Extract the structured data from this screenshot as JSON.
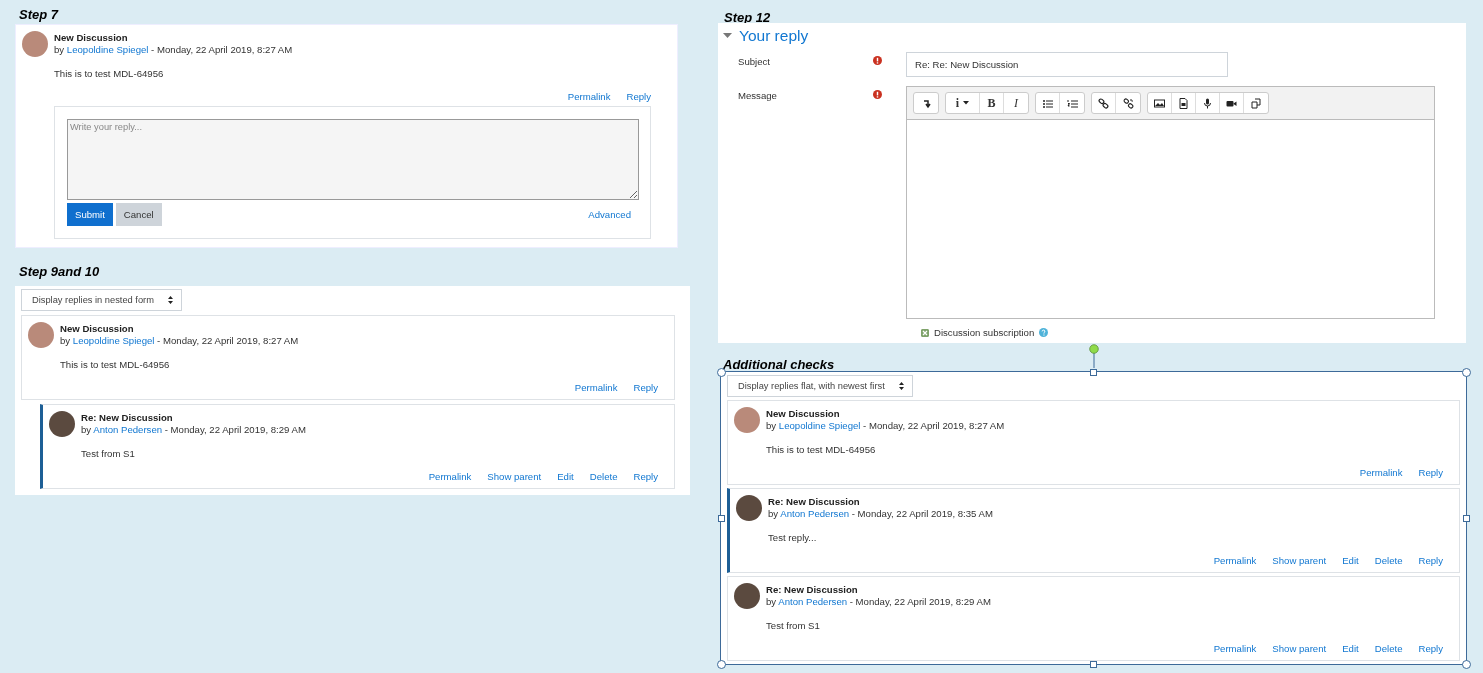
{
  "step7": {
    "caption": "Step 7",
    "post": {
      "subject": "New Discussion",
      "by": "by",
      "author": "Leopoldine Spiegel",
      "date": "- Monday, 22 April 2019, 8:27 AM",
      "message": "This is to test MDL-64956",
      "actions": [
        "Permalink",
        "Reply"
      ],
      "accent_bar": false
    },
    "reply_form": {
      "placeholder": "Write your reply...",
      "submit": "Submit",
      "cancel": "Cancel",
      "advanced": "Advanced"
    }
  },
  "step9": {
    "caption": "Step 9and 10",
    "display_mode": "Display replies in nested form",
    "posts": [
      {
        "subject": "New Discussion",
        "by": "by",
        "author": "Leopoldine Spiegel",
        "date": "- Monday, 22 April 2019, 8:27 AM",
        "message": "This is to test MDL-64956",
        "actions": [
          "Permalink",
          "Reply"
        ],
        "accent_bar": false,
        "children": [
          {
            "subject": "Re: New Discussion",
            "by": "by",
            "author": "Anton Pedersen",
            "date": "- Monday, 22 April 2019, 8:29 AM",
            "message": "Test from S1",
            "actions": [
              "Permalink",
              "Show parent",
              "Edit",
              "Delete",
              "Reply"
            ],
            "accent_bar": true
          }
        ]
      }
    ]
  },
  "step12": {
    "caption": "Step 12",
    "section_title": "Your reply",
    "expanded": true,
    "fields": [
      {
        "label": "Subject",
        "required": true,
        "value": "Re: Re: New Discussion"
      },
      {
        "label": "Message",
        "required": true
      }
    ],
    "editor": {
      "toolbar_text": [
        "i",
        "B",
        "I"
      ]
    },
    "subscription": {
      "label": "Discussion subscription",
      "checked": true
    }
  },
  "additional": {
    "caption": "Additional checks",
    "selected": true,
    "display_mode": "Display replies flat, with newest first",
    "posts": [
      {
        "subject": "New Discussion",
        "by": "by",
        "author": "Leopoldine Spiegel",
        "date": "- Monday, 22 April 2019, 8:27 AM",
        "message": "This is to test MDL-64956",
        "actions": [
          "Permalink",
          "Reply"
        ],
        "accent_bar": false
      },
      {
        "subject": "Re: New Discussion",
        "by": "by",
        "author": "Anton Pedersen",
        "date": "- Monday, 22 April 2019, 8:35 AM",
        "message": "Test reply...",
        "actions": [
          "Permalink",
          "Show parent",
          "Edit",
          "Delete",
          "Reply"
        ],
        "accent_bar": true
      },
      {
        "subject": "Re: New Discussion",
        "by": "by",
        "author": "Anton Pedersen",
        "date": "- Monday, 22 April 2019, 8:29 AM",
        "message": "Test from S1",
        "actions": [
          "Permalink",
          "Show parent",
          "Edit",
          "Delete",
          "Reply"
        ],
        "accent_bar": false
      }
    ]
  }
}
